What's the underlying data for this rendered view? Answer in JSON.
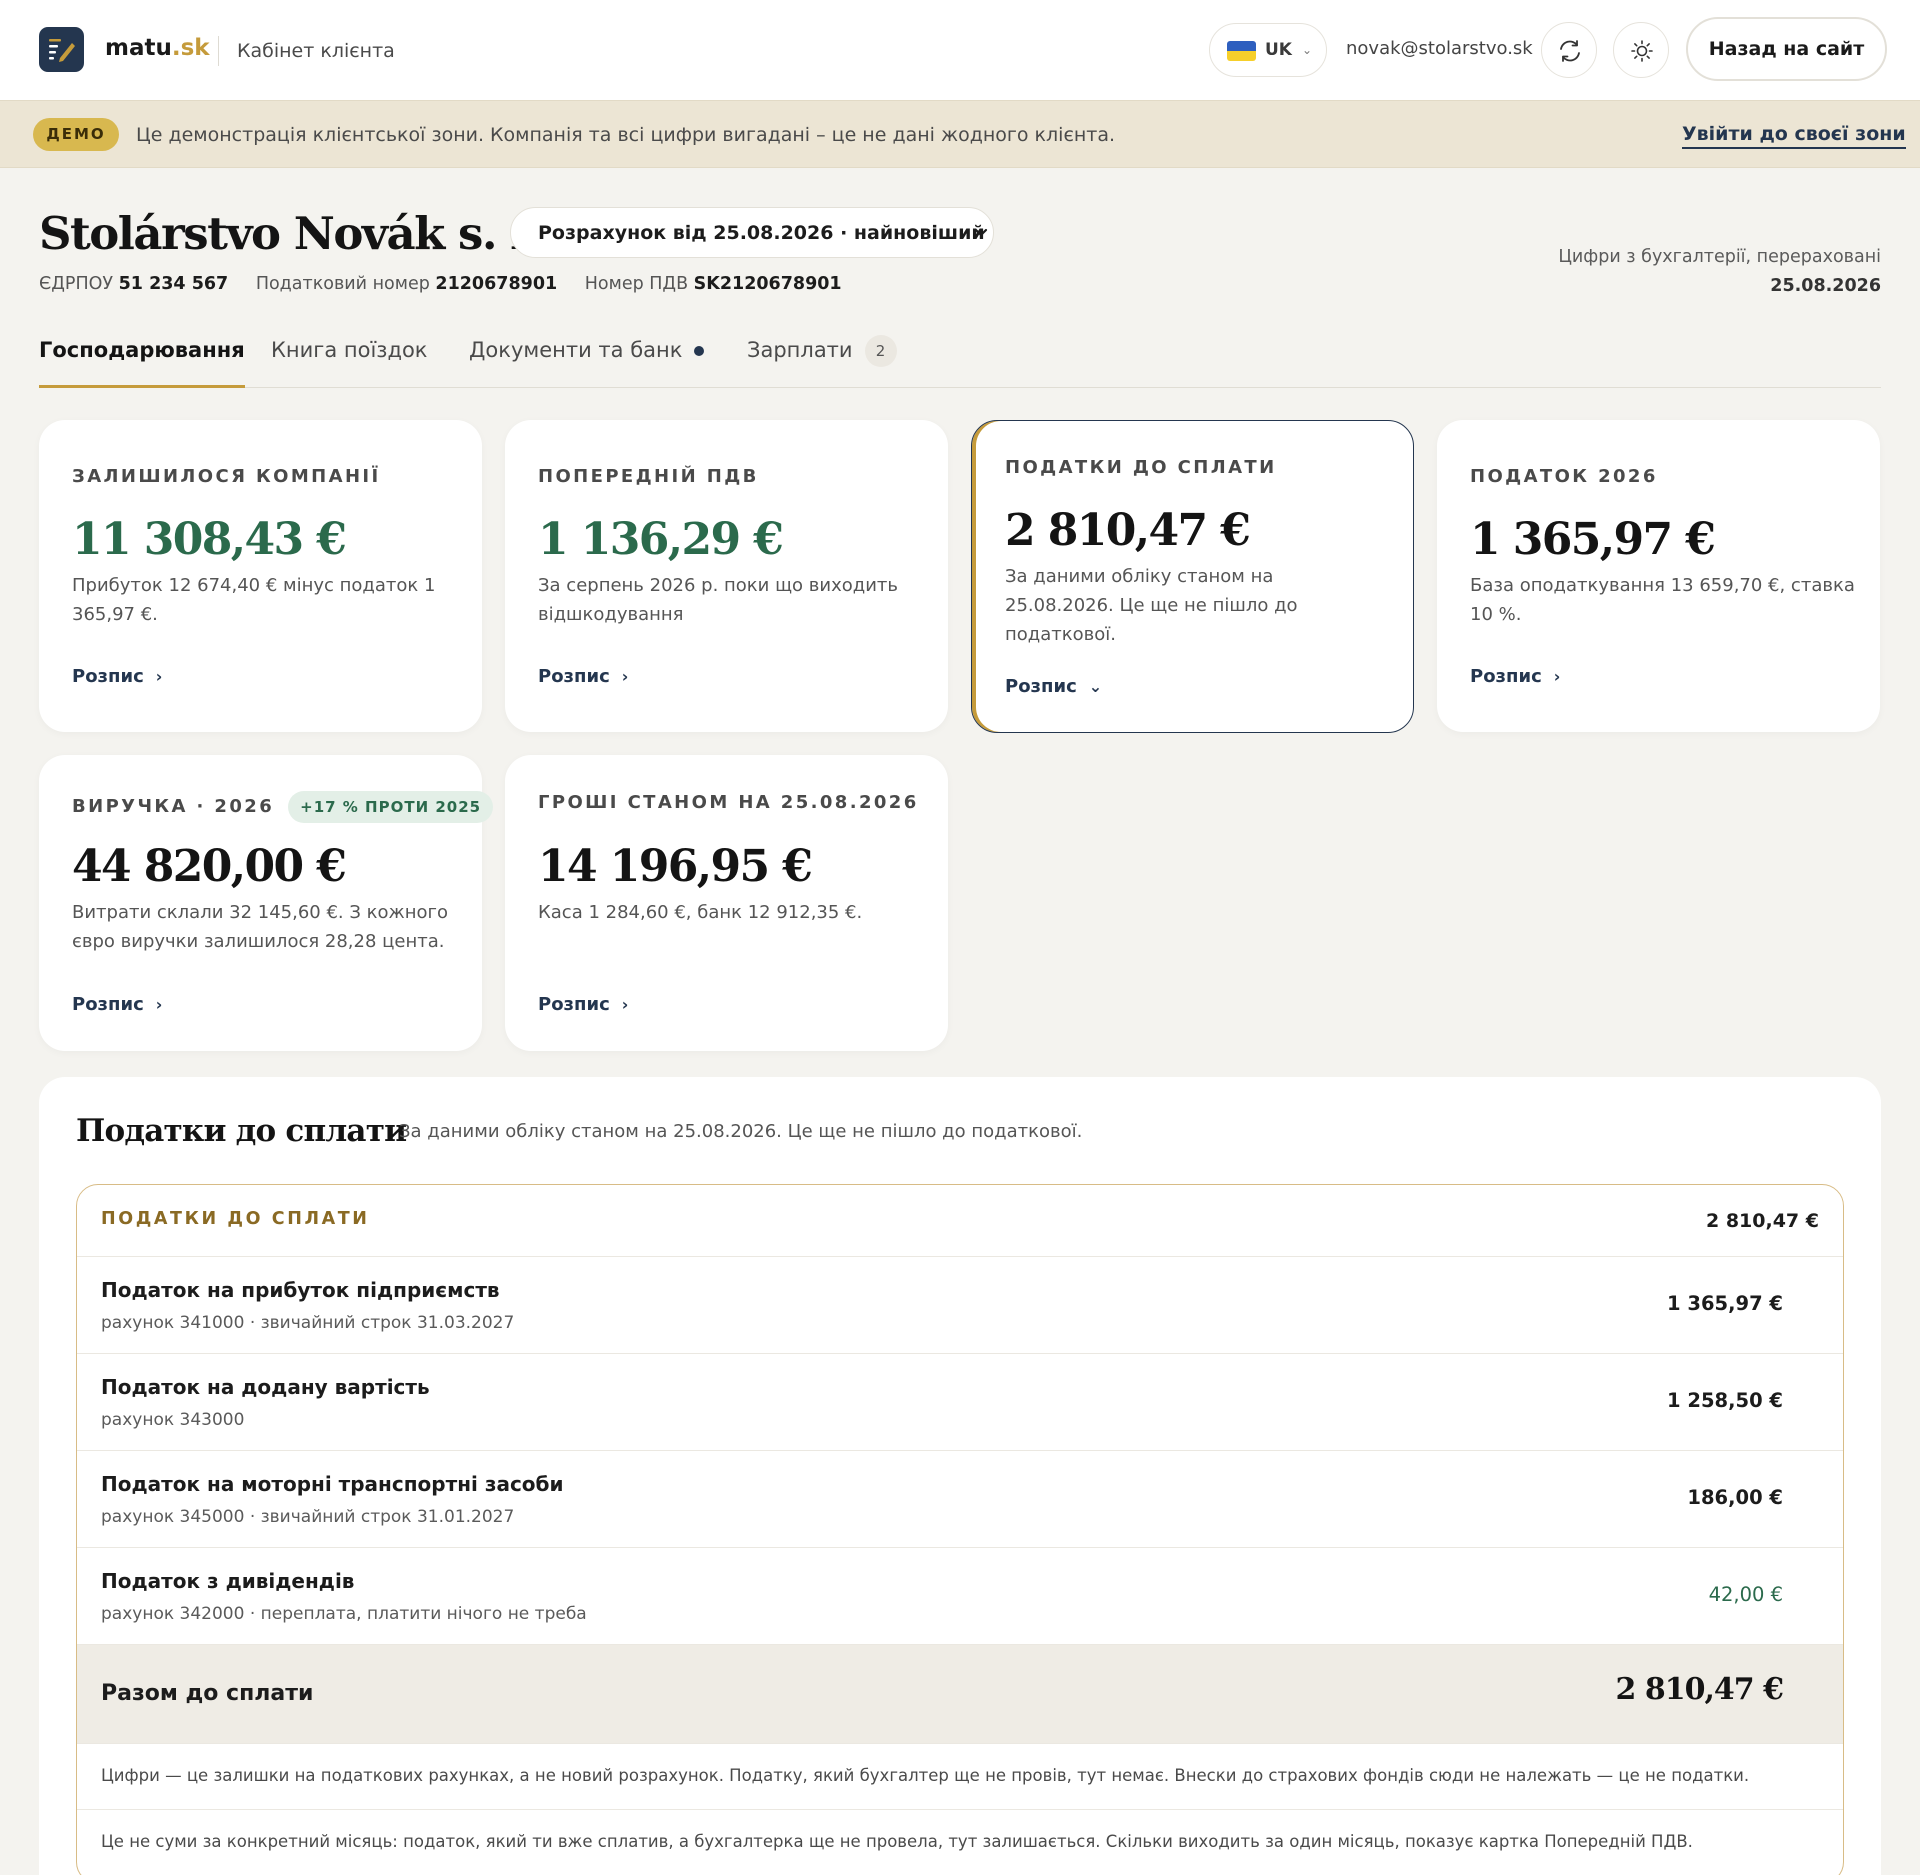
{
  "header": {
    "brand_name": "matu",
    "brand_tld": ".sk",
    "subtitle": "Кабінет клієнта",
    "language": "UK",
    "user_email": "novak@stolarstvo.sk",
    "back_button": "Назад на сайт",
    "icons": [
      "sync-icon",
      "sun-icon",
      "chevron-down-icon"
    ]
  },
  "demo_banner": {
    "badge": "ДЕМО",
    "text": "Це демонстрація клієнтської зони. Компанія та всі цифри вигадані – це не дані жодного клієнта.",
    "link": "Увійти до своєї зони"
  },
  "company": {
    "name": "Stolárstvo Novák s. r. o.",
    "calculation_select": "Розрахунок від 25.08.2026 · найновіший",
    "ids": [
      {
        "label": "ЄДРПОУ",
        "value": "51 234 567"
      },
      {
        "label": "Податковий номер",
        "value": "2120678901"
      },
      {
        "label": "Номер ПДВ",
        "value": "SK2120678901"
      }
    ],
    "accounting_note": "Цифри з бухгалтерії, перераховані",
    "accounting_date": "25.08.2026"
  },
  "tabs": [
    {
      "label": "Господарювання",
      "active": true
    },
    {
      "label": "Книга поїздок"
    },
    {
      "label": "Документи та банк",
      "dot": true
    },
    {
      "label": "Зарплати",
      "count": "2"
    }
  ],
  "cards": {
    "link_label": "Розпис",
    "remaining": {
      "label": "ЗАЛИШИЛОСЯ КОМПАНІЇ",
      "value": "11 308,43 €",
      "desc": "Прибуток 12 674,40 € мінус податок 1 365,97 €."
    },
    "vat_prev": {
      "label": "ПОПЕРЕДНІЙ ПДВ",
      "value": "1 136,29 €",
      "desc": "За серпень 2026 р. поки що виходить відшкодування"
    },
    "taxes_due": {
      "label": "ПОДАТКИ ДО СПЛАТИ",
      "value": "2 810,47 €",
      "desc": "За даними обліку станом на 25.08.2026. Це ще не пішло до податкової."
    },
    "tax_2026": {
      "label": "ПОДАТОК 2026",
      "value": "1 365,97 €",
      "desc": "База оподаткування 13 659,70 €, ставка 10 %."
    },
    "revenue": {
      "label": "ВИРУЧКА · 2026",
      "badge": "+17 % ПРОТИ 2025",
      "value": "44 820,00 €",
      "desc": "Витрати склали 32 145,60 €. З кожного євро виручки залишилося 28,28 цента."
    },
    "cash": {
      "label": "ГРОШІ СТАНОМ НА 25.08.2026",
      "value": "14 196,95 €",
      "desc": "Каса 1 284,60 €, банк 12 912,35 €."
    }
  },
  "taxes_panel": {
    "title": "Податки до сплати",
    "subtitle": "За даними обліку станом на 25.08.2026. Це ще не пішло до податкової.",
    "table_header_label": "ПОДАТКИ ДО СПЛАТИ",
    "table_header_value": "2 810,47 €",
    "rows": [
      {
        "name": "Податок на прибуток підприємств",
        "meta": "рахунок 341000 · звичайний строк 31.03.2027",
        "amount": "1 365,97 €"
      },
      {
        "name": "Податок на додану вартість",
        "meta": "рахунок 343000",
        "amount": "1 258,50 €"
      },
      {
        "name": "Податок на моторні транспортні засоби",
        "meta": "рахунок 345000 · звичайний строк 31.01.2027",
        "amount": "186,00 €"
      },
      {
        "name": "Податок з дивідендів",
        "meta": "рахунок 342000 · переплата, платити нічого не треба",
        "amount": "42,00 €"
      }
    ],
    "total_label": "Разом до сплати",
    "total_value": "2 810,47 €",
    "notes": [
      "Цифри — це залишки на податкових рахунках, а не новий розрахунок. Податку, який бухгалтер ще не провів, тут немає. Внески до страхових фондів сюди не належать — це не податки.",
      "Це не суми за конкретний місяць: податок, який ти вже сплатив, а бухгалтерка ще не провела, тут залишається. Скільки виходить за один місяць, показує картка Попередній ПДВ."
    ]
  },
  "colors": {
    "navy": "#24364f",
    "gold": "#c59b3b",
    "green": "#2b6a4c",
    "banner": "#ece5d4",
    "background": "#f4f3ef"
  }
}
